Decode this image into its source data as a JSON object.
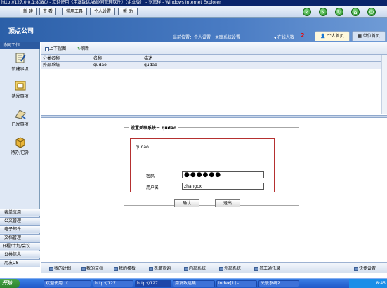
{
  "window": {
    "title": "http://127.0.0.1:8080/ - 欢迎使用《用友致远A8协同管理软件》（企业版） - 罗志祥 - Windows Internet Explorer"
  },
  "toolbar": {
    "buttons": [
      "新 建",
      "查 看",
      "常用工具",
      "个人设置",
      "帮 助"
    ]
  },
  "header": {
    "company": "顶点公司",
    "location": "当前位置：个人设置－关联系统设置",
    "online_label": "在线人数",
    "online_count": "2",
    "tabs": [
      "个人首页",
      "单位首页"
    ]
  },
  "sidebar": {
    "title": "协同工作",
    "items": [
      "新建事项",
      "待发事项",
      "已发事项",
      "待办/已办"
    ],
    "sections": [
      "表单应用",
      "公文管理",
      "电子邮件",
      "文档管理",
      "日程/计划/会议",
      "公共信息",
      "用友U8"
    ]
  },
  "main_toolbar": {
    "view_label": "上下视图",
    "refresh_label": "刷新"
  },
  "table": {
    "columns": [
      "分类名称",
      "名称",
      "描述"
    ],
    "rows": [
      [
        "外部系统",
        "qudao",
        "qudao"
      ]
    ]
  },
  "form": {
    "legend": "设置关联系统－ qudao",
    "system_name": "qudao",
    "password_label": "密码",
    "password_value": "●●●●●●",
    "username_label": "用户名",
    "username_value": "zhangcx",
    "confirm_label": "确认",
    "exit_label": "退出"
  },
  "bottom_links": [
    "我的计划",
    "我的文档",
    "我的模板",
    "表单查询",
    "内部系统",
    "外部系统",
    "员工通讯录"
  ],
  "shortcut_label": "快捷设置",
  "taskbar": {
    "start_label": "开始",
    "tasks": [
      "欢迎使用 《",
      "http://127...",
      "http://127...",
      "用友致远集...",
      "index[1] -...",
      "关联系统2..."
    ],
    "clock": "8:45"
  }
}
